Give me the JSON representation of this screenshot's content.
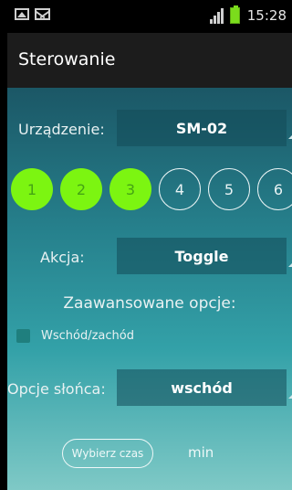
{
  "status_bar": {
    "time": "15:28"
  },
  "action_bar": {
    "title": "Sterowanie"
  },
  "device": {
    "label": "Urządzenie:",
    "value": "SM-02"
  },
  "channels": [
    {
      "label": "1",
      "active": true
    },
    {
      "label": "2",
      "active": true
    },
    {
      "label": "3",
      "active": true
    },
    {
      "label": "4",
      "active": false
    },
    {
      "label": "5",
      "active": false
    },
    {
      "label": "6",
      "active": false
    }
  ],
  "action": {
    "label": "Akcja:",
    "value": "Toggle"
  },
  "advanced": {
    "title": "Zaawansowane opcje:",
    "sun_checkbox_label": "Wschód/zachód",
    "sun_option_label": "Opcje słońca:",
    "sun_option_value": "wschód",
    "pick_time_button": "Wybierz czas",
    "unit": "min"
  }
}
